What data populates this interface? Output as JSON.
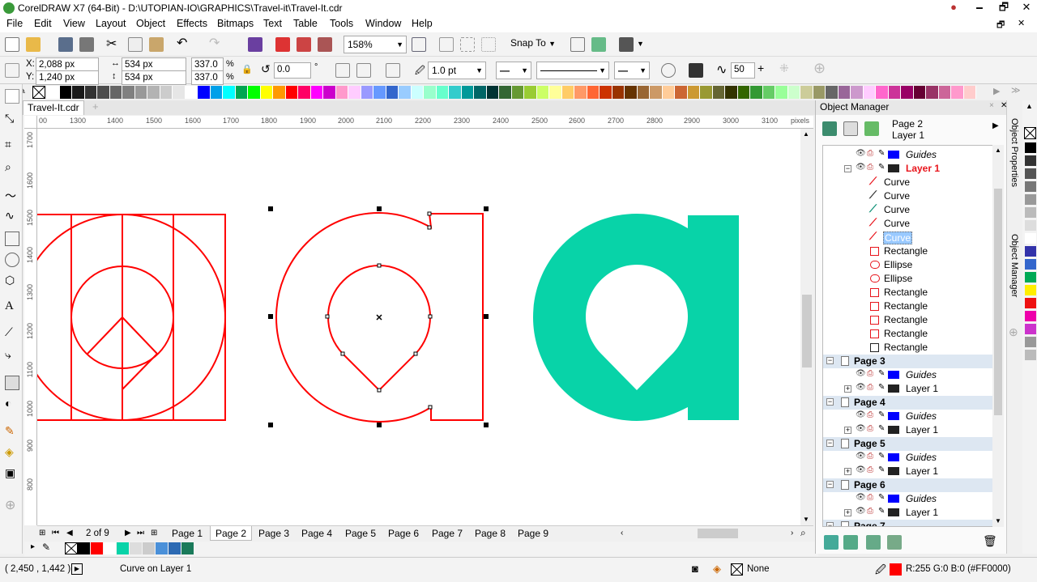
{
  "window": {
    "title": "CorelDRAW X7 (64-Bit) - D:\\UTOPIAN-IO\\GRAPHICS\\Travel-it\\Travel-It.cdr",
    "controls": [
      "🗕",
      "🗗",
      "✕"
    ]
  },
  "menu": [
    "File",
    "Edit",
    "View",
    "Layout",
    "Object",
    "Effects",
    "Bitmaps",
    "Text",
    "Table",
    "Tools",
    "Window",
    "Help"
  ],
  "toolbar": {
    "zoom": "158%",
    "snap_to": "Snap To"
  },
  "properties": {
    "x": "2,088 px",
    "y": "1,240 px",
    "width": "534 px",
    "height": "534 px",
    "scale_x": "337.0",
    "scale_y": "337.0",
    "percent": "%",
    "rotation": "0.0",
    "degree": "°",
    "outline_width": "1.0 pt",
    "nudge": "50"
  },
  "document_tab": "Travel-It.cdr",
  "ruler": {
    "h_ticks": [
      "00",
      "1300",
      "1400",
      "1500",
      "1600",
      "1700",
      "1800",
      "1900",
      "2000",
      "2100",
      "2200",
      "2300",
      "2400",
      "2500",
      "2600",
      "2700",
      "2800",
      "2900",
      "3000",
      "3100"
    ],
    "unit": "pixels",
    "v_ticks": [
      "1700",
      "1600",
      "1500",
      "1400",
      "1300",
      "1200",
      "1100",
      "1000",
      "900",
      "800"
    ]
  },
  "page_nav": {
    "counter": "2 of 9",
    "pages": [
      "Page 1",
      "Page 2",
      "Page 3",
      "Page 4",
      "Page 5",
      "Page 6",
      "Page 7",
      "Page 8",
      "Page 9"
    ],
    "active_index": 1
  },
  "status": {
    "coords": "( 2,450 , 1,442 )",
    "selection": "Curve on Layer 1",
    "fill": "None",
    "outline": "R:255 G:0 B:0 (#FF0000)"
  },
  "object_manager": {
    "title": "Object Manager",
    "header_page": "Page 2",
    "header_layer": "Layer 1",
    "rows": [
      {
        "kind": "layer",
        "label": "Guides",
        "italic": true,
        "color": "#0000ff"
      },
      {
        "kind": "layer",
        "label": "Layer 1",
        "active": true,
        "color": "#222222"
      },
      {
        "kind": "object",
        "label": "Curve",
        "icon": "curve-red"
      },
      {
        "kind": "object",
        "label": "Curve",
        "icon": "curve-dark"
      },
      {
        "kind": "object",
        "label": "Curve",
        "icon": "curve-teal"
      },
      {
        "kind": "object",
        "label": "Curve",
        "icon": "curve-red"
      },
      {
        "kind": "object",
        "label": "Curve",
        "icon": "curve-red",
        "selected": true
      },
      {
        "kind": "object",
        "label": "Rectangle",
        "icon": "rect-red"
      },
      {
        "kind": "object",
        "label": "Ellipse",
        "icon": "ellipse-red"
      },
      {
        "kind": "object",
        "label": "Ellipse",
        "icon": "ellipse-red"
      },
      {
        "kind": "object",
        "label": "Rectangle",
        "icon": "rect-red"
      },
      {
        "kind": "object",
        "label": "Rectangle",
        "icon": "rect-red"
      },
      {
        "kind": "object",
        "label": "Rectangle",
        "icon": "rect-red"
      },
      {
        "kind": "object",
        "label": "Rectangle",
        "icon": "rect-red"
      },
      {
        "kind": "object",
        "label": "Rectangle",
        "icon": "rect-dark"
      },
      {
        "kind": "page",
        "label": "Page 3"
      },
      {
        "kind": "layer",
        "label": "Guides",
        "italic": true,
        "color": "#0000ff"
      },
      {
        "kind": "layer",
        "label": "Layer 1",
        "color": "#222222"
      },
      {
        "kind": "page",
        "label": "Page 4"
      },
      {
        "kind": "layer",
        "label": "Guides",
        "italic": true,
        "color": "#0000ff"
      },
      {
        "kind": "layer",
        "label": "Layer 1",
        "color": "#222222"
      },
      {
        "kind": "page",
        "label": "Page 5"
      },
      {
        "kind": "layer",
        "label": "Guides",
        "italic": true,
        "color": "#0000ff"
      },
      {
        "kind": "layer",
        "label": "Layer 1",
        "color": "#222222"
      },
      {
        "kind": "page",
        "label": "Page 6"
      },
      {
        "kind": "layer",
        "label": "Guides",
        "italic": true,
        "color": "#0000ff"
      },
      {
        "kind": "layer",
        "label": "Layer 1",
        "color": "#222222"
      },
      {
        "kind": "page",
        "label": "Page 7"
      }
    ]
  },
  "docker_tabs": [
    "Object Properties",
    "Object Manager"
  ],
  "colors": {
    "outline_red": "#ff0000",
    "teal": "#08d3a8",
    "layer_red": "#e8141b",
    "selection_blue": "#99c9ff"
  },
  "palette": [
    "#ffffff",
    "#000000",
    "#1a1a1a",
    "#333333",
    "#4d4d4d",
    "#666666",
    "#808080",
    "#999999",
    "#b3b3b3",
    "#cccccc",
    "#e6e6e6",
    "#ffffff",
    "#0000ff",
    "#00a0e9",
    "#00ffff",
    "#00a651",
    "#00ff00",
    "#ffff00",
    "#ff9900",
    "#ff0000",
    "#ff0066",
    "#ff00ff",
    "#cc00cc",
    "#ff99cc",
    "#ffccff",
    "#9999ff",
    "#6699ff",
    "#3366cc",
    "#99ccff",
    "#ccffff",
    "#99ffcc",
    "#66ffcc",
    "#33cccc",
    "#009999",
    "#006666",
    "#003333",
    "#336633",
    "#669933",
    "#99cc33",
    "#ccff66",
    "#ffff99",
    "#ffcc66",
    "#ff9966",
    "#ff6633",
    "#cc3300",
    "#993300",
    "#663300",
    "#996633",
    "#cc9966",
    "#ffcc99",
    "#cc6633",
    "#cc9933",
    "#999933",
    "#666633",
    "#333300",
    "#336600",
    "#339933",
    "#66cc66",
    "#99ff99",
    "#ccffcc",
    "#cccc99",
    "#999966",
    "#666666",
    "#996699",
    "#cc99cc",
    "#ffccff",
    "#ff66cc",
    "#cc3399",
    "#990066",
    "#660033",
    "#993366",
    "#cc6699",
    "#ff99cc",
    "#ffcccc"
  ],
  "doc_palette": [
    "#000000",
    "#ff0000",
    "#ffffff",
    "#08d3a8",
    "#dddddd",
    "#cccccc",
    "#4a90d9",
    "#2d6ab3",
    "#1a7a5a"
  ],
  "right_palette": [
    "#000000",
    "#333333",
    "#555555",
    "#777777",
    "#999999",
    "#bbbbbb",
    "#dddddd",
    "#ffffff",
    "#3333aa",
    "#3366cc",
    "#00aa55",
    "#ffee00",
    "#ee1111",
    "#ee00aa",
    "#cc33cc",
    "#999999",
    "#bbbbbb"
  ]
}
